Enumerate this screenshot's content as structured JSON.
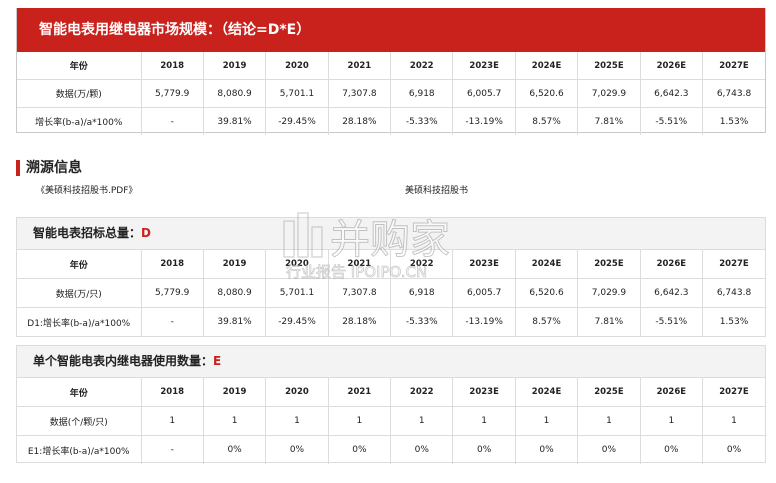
{
  "banner": {
    "title": "智能电表用继电器市场规模：（结论=D*E）"
  },
  "years": [
    "2018",
    "2019",
    "2020",
    "2021",
    "2022",
    "2023E",
    "2024E",
    "2025E",
    "2026E",
    "2027E"
  ],
  "main_table": {
    "year_label": "年份",
    "rows": [
      {
        "label": "数据(万/颗)",
        "values": [
          "5,779.9",
          "8,080.9",
          "5,701.1",
          "7,307.8",
          "6,918",
          "6,005.7",
          "6,520.6",
          "7,029.9",
          "6,642.3",
          "6,743.8"
        ]
      },
      {
        "label": "增长率(b-a)/a*100%",
        "values": [
          "-",
          "39.81%",
          "-29.45%",
          "28.18%",
          "-5.33%",
          "-13.19%",
          "8.57%",
          "7.81%",
          "-5.51%",
          "1.53%"
        ]
      }
    ]
  },
  "trace": {
    "title": "溯源信息",
    "source_doc": "《美硕科技招股书.PDF》",
    "source_name": "美硕科技招股书"
  },
  "section_d": {
    "title": "智能电表招标总量：",
    "mark": "D",
    "year_label": "年份",
    "rows": [
      {
        "label": "数据(万/只)",
        "values": [
          "5,779.9",
          "8,080.9",
          "5,701.1",
          "7,307.8",
          "6,918",
          "6,005.7",
          "6,520.6",
          "7,029.9",
          "6,642.3",
          "6,743.8"
        ]
      },
      {
        "label": "D1:增长率(b-a)/a*100%",
        "values": [
          "-",
          "39.81%",
          "-29.45%",
          "28.18%",
          "-5.33%",
          "-13.19%",
          "8.57%",
          "7.81%",
          "-5.51%",
          "1.53%"
        ]
      }
    ]
  },
  "section_e": {
    "title": "单个智能电表内继电器使用数量：",
    "mark": "E",
    "year_label": "年份",
    "rows": [
      {
        "label": "数据(个/颗/只)",
        "values": [
          "1",
          "1",
          "1",
          "1",
          "1",
          "1",
          "1",
          "1",
          "1",
          "1"
        ]
      },
      {
        "label": "E1:增长率(b-a)/a*100%",
        "values": [
          "-",
          "0%",
          "0%",
          "0%",
          "0%",
          "0%",
          "0%",
          "0%",
          "0%",
          "0%"
        ]
      }
    ]
  },
  "watermark": {
    "main": "并购家",
    "sub": "行业报告 IPOIPO.CN"
  }
}
